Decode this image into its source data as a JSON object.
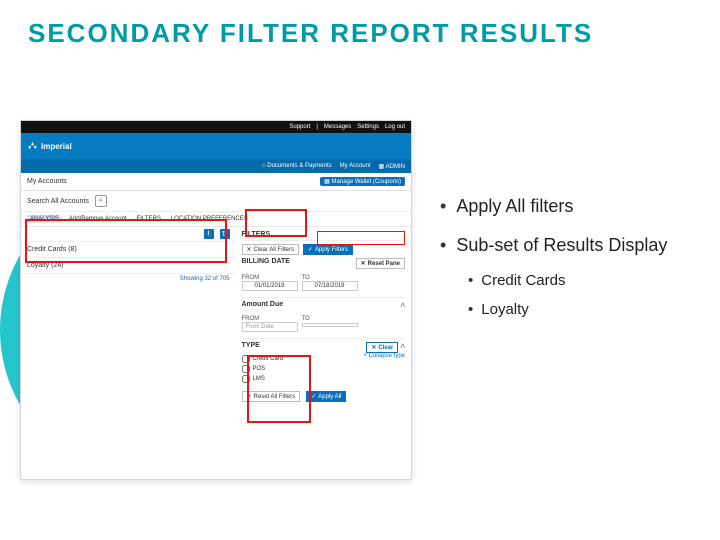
{
  "slide": {
    "title": "SECONDARY FILTER REPORT RESULTS",
    "bullets": [
      "Apply All filters",
      "Sub-set of Results Display"
    ],
    "sub_bullets": [
      "Credit Cards",
      "Loyalty"
    ]
  },
  "topbar": {
    "support": "Support",
    "messages": "Messages",
    "settings": "Settings",
    "logout": "Log out"
  },
  "brand": "Imperial",
  "nav": {
    "documents": "Documents & Payments",
    "my_account": "My Account",
    "admin": "ADMIN"
  },
  "subhead": {
    "title": "My Accounts",
    "link": "Manage Wallet (Coupons)"
  },
  "search": {
    "label": "Search All Accounts",
    "icon": "⌕"
  },
  "tabs": [
    "ANALYSIS",
    "Add/Remove Account",
    "FILTERS",
    "LOCATION PREFERENCES"
  ],
  "accounts": [
    {
      "name": "Credit Cards (8)"
    },
    {
      "name": "Loyalty (24)"
    }
  ],
  "toolbar": {
    "export": "⭳",
    "sort": "⇅"
  },
  "showing": "Showing 32 of 705",
  "filters": {
    "title": "FILTERS",
    "clear": "Clear All Filters",
    "apply": "Apply Filters",
    "reset_pane": "Reset Pane"
  },
  "bill_date": {
    "title": "BILLING DATE",
    "from": "FROM",
    "to": "TO",
    "from_v": "01/01/2019",
    "to_v": "07/18/2019"
  },
  "amount": {
    "title": "Amount Due",
    "from": "FROM",
    "to": "TO",
    "placeholder": "From Date"
  },
  "type": {
    "title": "TYPE",
    "clear": "Clear",
    "opts": [
      "Credit Card",
      "POS",
      "LMS"
    ],
    "count": "Collapse type"
  },
  "footer": {
    "reset": "Reset All Filters",
    "apply": "Apply All"
  }
}
